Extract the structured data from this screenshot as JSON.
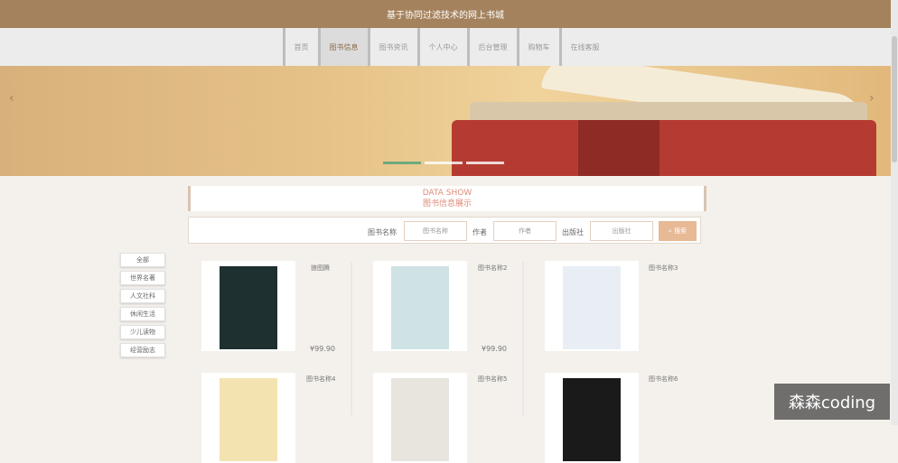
{
  "header": {
    "title": "基于协同过滤技术的网上书城"
  },
  "nav": {
    "items": [
      "首页",
      "图书信息",
      "图书资讯",
      "个人中心",
      "后台管理",
      "购物车",
      "在线客服"
    ],
    "active_index": 1
  },
  "banner": {
    "prev_icon": "chevron-left-icon",
    "next_icon": "chevron-right-icon"
  },
  "section": {
    "title_en": "DATA SHOW",
    "title_cn": "图书信息展示"
  },
  "search": {
    "book_name_label": "图书名称",
    "book_name_placeholder": "图书名称",
    "author_label": "作者",
    "author_placeholder": "作者",
    "publisher_label": "出版社",
    "publisher_placeholder": "出版社",
    "button_label": "搜索",
    "button_icon": "search-icon"
  },
  "categories": [
    "全部",
    "世界名著",
    "人文社科",
    "休闲生活",
    "少儿读物",
    "经营励志"
  ],
  "books": [
    {
      "title": "狼图腾",
      "price": "¥99.90"
    },
    {
      "title": "图书名称2",
      "price": "¥99.90"
    },
    {
      "title": "图书名称3",
      "price": ""
    },
    {
      "title": "图书名称4",
      "price": ""
    },
    {
      "title": "图书名称5",
      "price": ""
    },
    {
      "title": "图书名称6",
      "price": ""
    }
  ],
  "watermark": {
    "text": "森森coding"
  },
  "colors": {
    "accent": "#a4825d",
    "highlight": "#e08b7a",
    "button": "#e7b995"
  }
}
